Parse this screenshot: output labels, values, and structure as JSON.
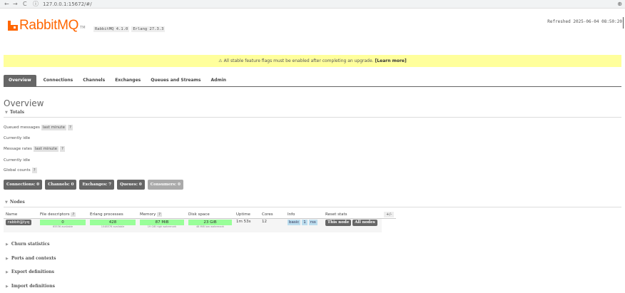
{
  "browser": {
    "back": "←",
    "forward": "→",
    "reload": "C",
    "info": "ⓘ",
    "url": "127.0.0.1:15672/#/",
    "ext": "⊕"
  },
  "header": {
    "logo_text": "RabbitMQ",
    "tm": "TM",
    "rabbitmq_version": "RabbitMQ 4.1.0",
    "erlang_version": "Erlang 27.3.3",
    "refreshed": "Refreshed 2025-06-04 08:50:20"
  },
  "banner": {
    "icon": "⚠",
    "text": "All stable feature flags must be enabled after completing an upgrade.",
    "link": "[Learn more]"
  },
  "tabs": [
    "Overview",
    "Connections",
    "Channels",
    "Exchanges",
    "Queues and Streams",
    "Admin"
  ],
  "page_title": "Overview",
  "totals": {
    "header": "Totals",
    "queued_label": "Queued messages",
    "queued_range": "last minute",
    "help": "?",
    "idle1": "Currently idle",
    "rates_label": "Message rates",
    "rates_range": "last minute",
    "idle2": "Currently idle",
    "global_label": "Global counts"
  },
  "counts": [
    {
      "label": "Connections: 0",
      "dim": false
    },
    {
      "label": "Channels: 0",
      "dim": false
    },
    {
      "label": "Exchanges: 7",
      "dim": false
    },
    {
      "label": "Queues: 0",
      "dim": false
    },
    {
      "label": "Consumers: 0",
      "dim": true
    }
  ],
  "nodes": {
    "header": "Nodes",
    "columns": [
      "Name",
      "File descriptors",
      "Erlang processes",
      "Memory",
      "Disk space",
      "Uptime",
      "Cores",
      "Info",
      "Reset stats"
    ],
    "plusminus": "+/-",
    "row": {
      "name": "rabbit@lyq",
      "fd": "0",
      "fd_sub": "65536 available",
      "erl": "428",
      "erl_sub": "1048576 available",
      "mem": "87 MiB",
      "mem_sub": "19 GiB high watermark",
      "disk": "23 GiB",
      "disk_sub": "48 MiB low watermark",
      "uptime": "1m 53s",
      "cores": "12",
      "info": [
        "basic",
        "1",
        "rss"
      ],
      "reset": [
        "This node",
        "All nodes"
      ]
    }
  },
  "collapsed_sections": [
    "Churn statistics",
    "Ports and contexts",
    "Export definitions",
    "Import definitions"
  ]
}
